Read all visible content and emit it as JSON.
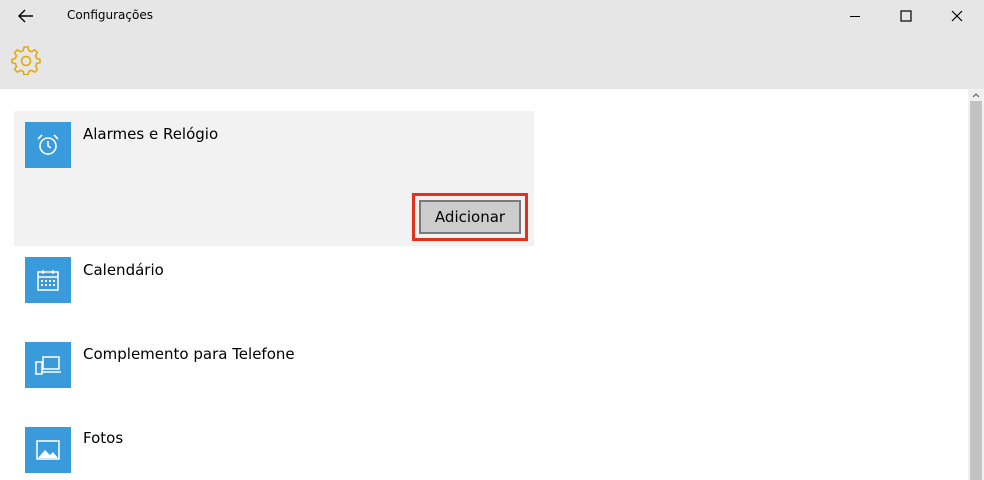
{
  "window": {
    "title": "Configurações",
    "back_icon": "arrow-left-icon",
    "controls": [
      "minimize-icon",
      "maximize-icon",
      "close-icon"
    ]
  },
  "header": {
    "icon": "gear-icon",
    "accent": "#e0a800"
  },
  "apps": [
    {
      "name": "Alarmes e Relógio",
      "icon": "alarm-clock-icon",
      "selected": true
    },
    {
      "name": "Calendário",
      "icon": "calendar-icon",
      "selected": false
    },
    {
      "name": "Complemento para Telefone",
      "icon": "phone-companion-icon",
      "selected": false
    },
    {
      "name": "Fotos",
      "icon": "photos-icon",
      "selected": false
    }
  ],
  "selected_app": {
    "add_label": "Adicionar",
    "highlight_color": "#e2321c"
  },
  "colors": {
    "tile": "#3a9bdc",
    "titlebar": "#e6e6e6"
  }
}
